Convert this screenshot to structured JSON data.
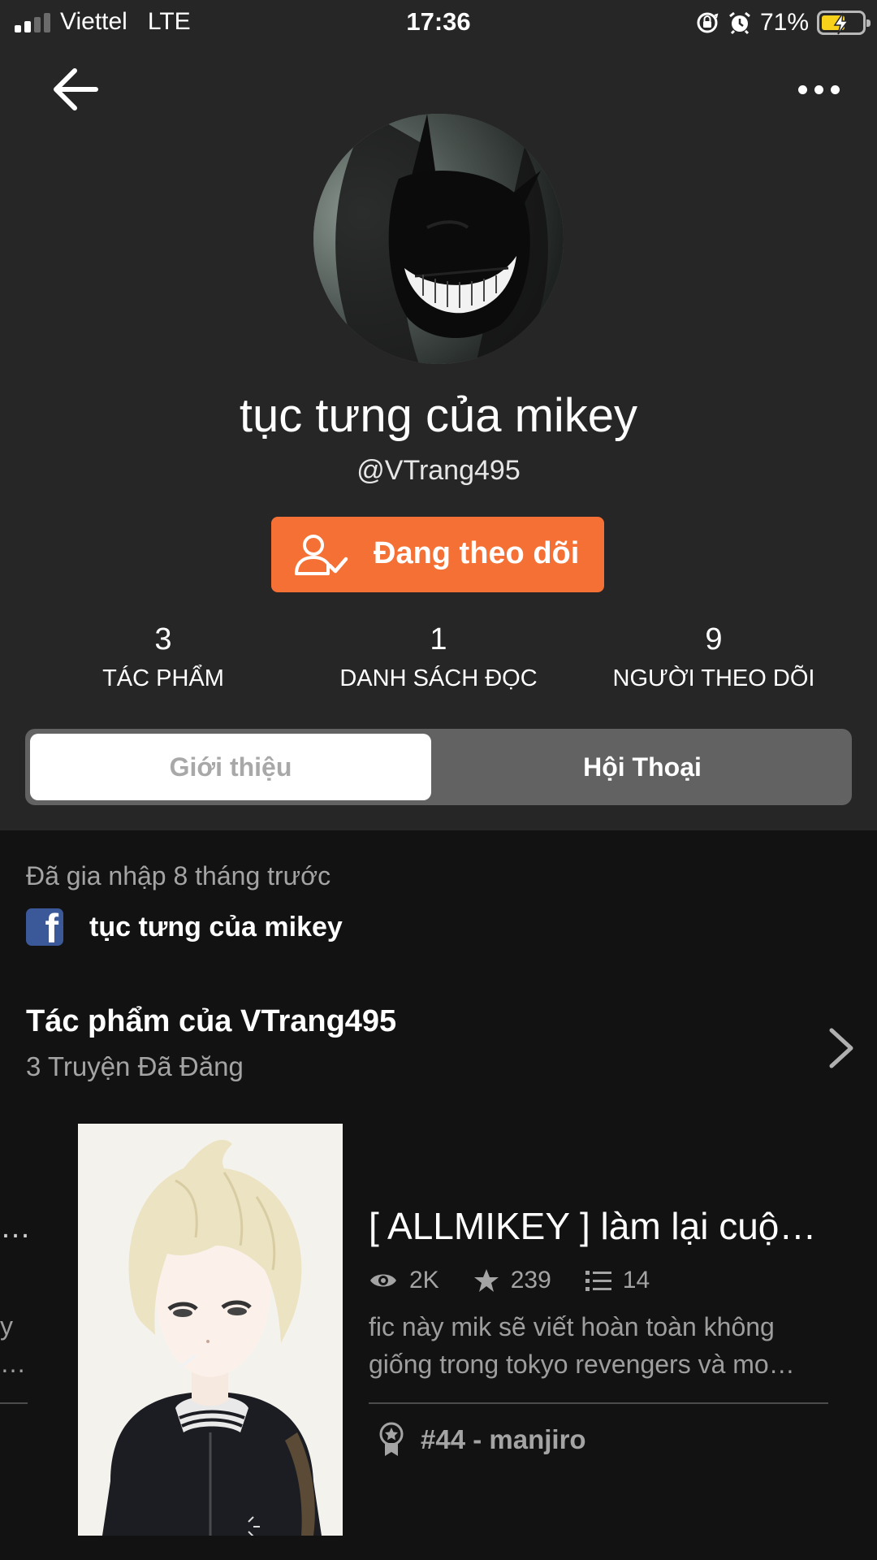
{
  "status_bar": {
    "carrier": "Viettel",
    "network": "LTE",
    "time": "17:36",
    "battery": "71%"
  },
  "profile": {
    "display_name": "tục tưng của mikey",
    "username": "@VTrang495",
    "follow_button": "Đang theo dõi",
    "stats": [
      {
        "value": "3",
        "label": "TÁC PHẨM"
      },
      {
        "value": "1",
        "label": "DANH SÁCH ĐỌC"
      },
      {
        "value": "9",
        "label": "NGƯỜI THEO DÕI"
      }
    ],
    "tabs": [
      {
        "label": "Giới thiệu",
        "selected": true
      },
      {
        "label": "Hội Thoại",
        "selected": false
      }
    ]
  },
  "about": {
    "joined": "Đã gia nhập 8 tháng trước",
    "facebook_name": "tục tưng của mikey"
  },
  "works": {
    "title": "Tác phẩm của VTrang495",
    "subtitle": "3 Truyện Đã Đăng",
    "previous_fragments": [
      "…",
      "y",
      "…"
    ],
    "story": {
      "title": "[ ALLMIKEY ] làm lại cuộ…",
      "reads": "2K",
      "votes": "239",
      "parts": "14",
      "description_lines": [
        "fic này mik sẽ viết hoàn toàn không",
        "giống trong tokyo revengers và mo…"
      ],
      "rank": "#44 - manjiro"
    }
  },
  "colors": {
    "accent": "#f47035",
    "header_bg": "#262626",
    "page_bg": "#121212",
    "facebook": "#3b5998"
  },
  "icons": [
    "back-arrow-icon",
    "more-dots-icon",
    "user-check-icon",
    "facebook-icon",
    "chevron-right-icon",
    "eye-icon",
    "star-icon",
    "list-icon",
    "award-icon"
  ]
}
